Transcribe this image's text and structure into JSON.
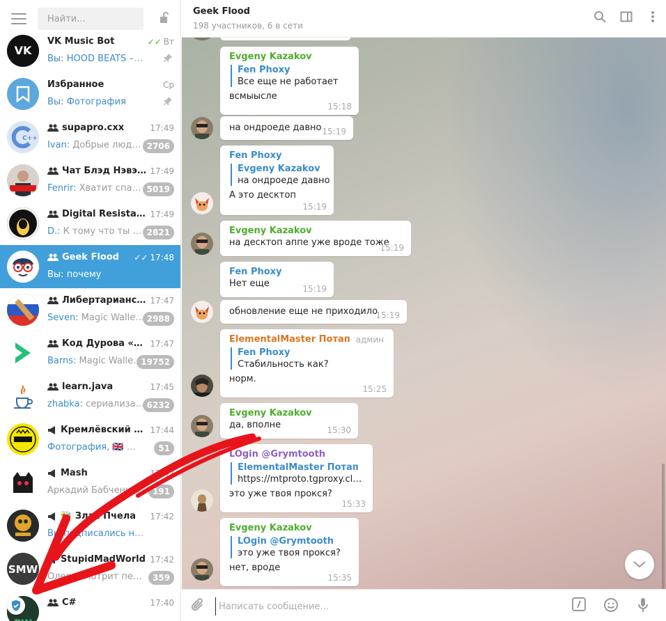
{
  "sidebar": {
    "search": {
      "placeholder": "Найти..."
    },
    "chats": [
      {
        "name": "VK Music Bot",
        "time": "Вт",
        "read": true,
        "pinned": true,
        "sender": "Вы:",
        "preview": "HOOD BEATS – ухо...",
        "type": "bot"
      },
      {
        "name": "Избранное",
        "time": "Ср",
        "pinned": true,
        "sender": "Вы:",
        "preview": "Фотография",
        "type": "saved"
      },
      {
        "name": "supapro.cxx",
        "time": "17:49",
        "sender": "Ivan:",
        "preview": "Добрые люди, ...",
        "badge": "2706",
        "type": "group"
      },
      {
        "name": "Чат Блэд Нэвэль...",
        "time": "17:49",
        "sender": "Fenrir:",
        "preview": "Хватит спами...",
        "badge": "5019",
        "type": "group"
      },
      {
        "name": "Digital Resistance...",
        "time": "17:49",
        "sender": "D.:",
        "preview": "К тому что ты с н...",
        "badge": "2821",
        "type": "group"
      },
      {
        "name": "Geek Flood",
        "time": "17:48",
        "read": true,
        "sender": "Вы:",
        "preview": "почему",
        "type": "group",
        "active": true
      },
      {
        "name": "Либертарианск...",
        "time": "17:47",
        "sender": "Seven:",
        "preview": "Magic Wallet ...",
        "badge": "2988",
        "type": "group"
      },
      {
        "name": "Код Дурова «Чат»",
        "time": "17:47",
        "sender": "Barns:",
        "preview": "Magic Wallet ...",
        "badge": "19752",
        "type": "group"
      },
      {
        "name": "learn.java",
        "time": "17:45",
        "sender": "zhabka:",
        "preview": "сериализац...",
        "badge": "6232",
        "type": "group"
      },
      {
        "name": "Кремлёвский ма...",
        "time": "17:44",
        "sender": "Фотография,",
        "preview": "🇬🇧 🖼 Се...",
        "badge": "51",
        "type": "channel"
      },
      {
        "name": "Mash",
        "time": "17:42",
        "sender": "",
        "preview": "Аркадий Бабченко ...",
        "badge": "191",
        "type": "channel"
      },
      {
        "name": "🐝 Злая Пчела",
        "time": "17:42",
        "sender": "",
        "preview": "Вы подписались на канал",
        "type": "channel",
        "preview_blue": true
      },
      {
        "name": "StupidMadWorld",
        "time": "17:42",
        "sender": "",
        "preview": "Олега смотрит перв...",
        "badge": "359",
        "type": "channel"
      },
      {
        "name": "C#",
        "time": "17:40",
        "sender": "",
        "preview": "",
        "type": "group"
      }
    ],
    "avatars": {
      "a3": "C++",
      "a12": "SMW",
      "a13": "PW"
    }
  },
  "header": {
    "title": "Geek Flood",
    "subtitle": "198 участников, 6 в сети"
  },
  "messages": [
    {
      "sender": "Evgeny Kazakov",
      "sender_color": "#4fad2d",
      "reply_name": "Fen Phoxy",
      "reply_text": "Все еще не работает",
      "text": "всмыысле",
      "time": "15:18"
    },
    {
      "sender": "",
      "text": "на ондроеде давно",
      "time": "15:19"
    },
    {
      "sender": "Fen Phoxy",
      "sender_color": "#3a8cc8",
      "reply_name": "Evgeny Kazakov",
      "reply_text": "на ондроеде давно",
      "text": "А это десктоп",
      "time": "15:19"
    },
    {
      "sender": "Evgeny Kazakov",
      "sender_color": "#4fad2d",
      "text": "на десктоп аппе уже вроде тоже",
      "time": "15:19"
    },
    {
      "sender": "Fen Phoxy",
      "sender_color": "#3a8cc8",
      "text": "Нет еще",
      "time": "15:19"
    },
    {
      "sender": "",
      "text": "обновление еще не приходило",
      "time": "15:19"
    },
    {
      "sender": "ElementalMaster Потап",
      "sender_color": "#d67722",
      "admin": "админ",
      "reply_name": "Fen Phoxy",
      "reply_text": "Стабильность как?",
      "text": "норм.",
      "time": "15:25"
    },
    {
      "sender": "Evgeny Kazakov",
      "sender_color": "#4fad2d",
      "text": "да, вполне",
      "time": "15:30"
    },
    {
      "sender": "LOgin @Grymtooth",
      "sender_color": "#8e5fc1",
      "reply_name": "ElementalMaster Потап",
      "reply_text": "https://mtproto.tgproxy.clou...",
      "text": "это уже твоя прокся?",
      "time": "15:33"
    },
    {
      "sender": "Evgeny Kazakov",
      "sender_color": "#4fad2d",
      "reply_name": "LOgin @Grymtooth",
      "reply_text": "это уже твоя прокся?",
      "text": "нет, вроде",
      "time": "15:35"
    }
  ],
  "composer": {
    "placeholder": "Написать сообщение..."
  },
  "colors": {
    "accent": "#419fd9",
    "annotation_arrow": "#e8141b"
  }
}
